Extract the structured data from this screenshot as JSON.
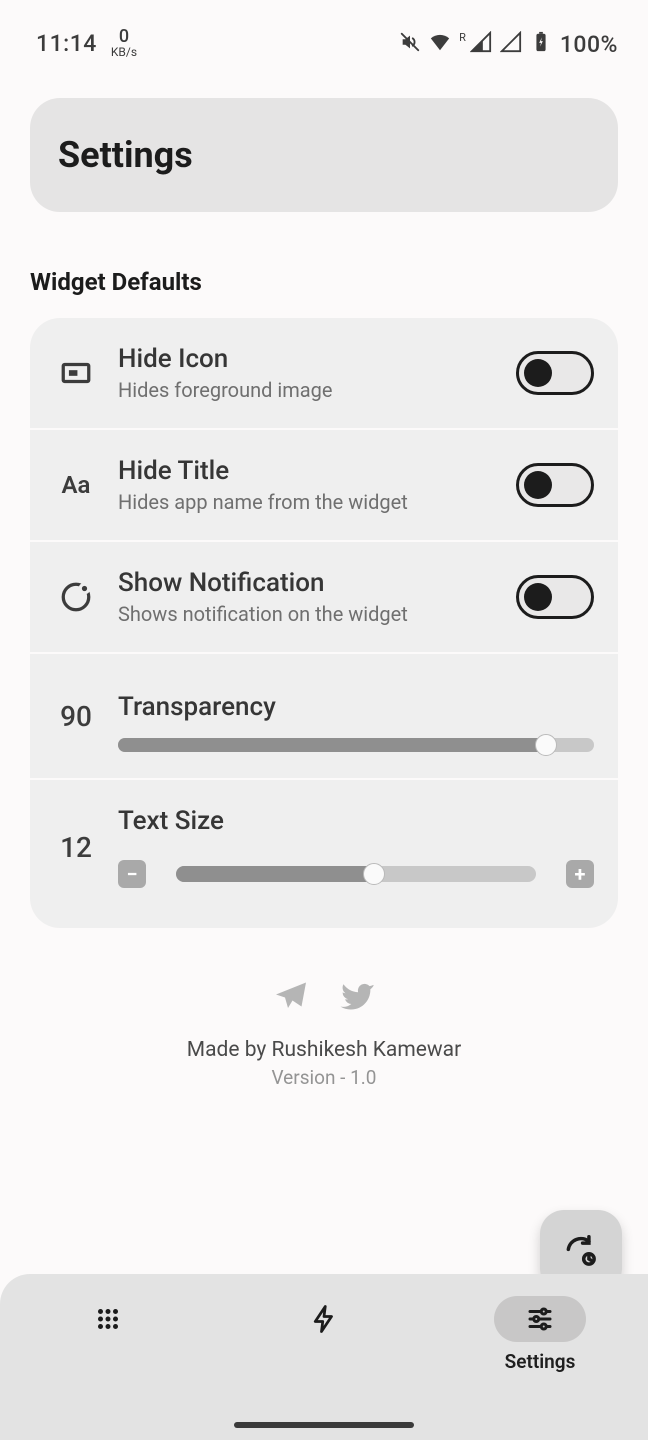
{
  "status": {
    "time": "11:14",
    "net_speed_value": "0",
    "net_speed_unit": "KB/s",
    "battery_text": "100%"
  },
  "page": {
    "title": "Settings",
    "section": "Widget Defaults"
  },
  "settings": {
    "hide_icon": {
      "title": "Hide Icon",
      "sub": "Hides foreground image",
      "on": false
    },
    "hide_title": {
      "title": "Hide Title",
      "sub": "Hides app name from the widget",
      "on": false
    },
    "show_notification": {
      "title": "Show Notification",
      "sub": "Shows notification on the widget",
      "on": false
    },
    "transparency": {
      "title": "Transparency",
      "value": "90",
      "percent": 90
    },
    "text_size": {
      "title": "Text Size",
      "value": "12",
      "percent": 55
    }
  },
  "credits": {
    "made_by": "Made by Rushikesh Kamewar",
    "version": "Version - 1.0"
  },
  "nav": {
    "settings_label": "Settings"
  }
}
